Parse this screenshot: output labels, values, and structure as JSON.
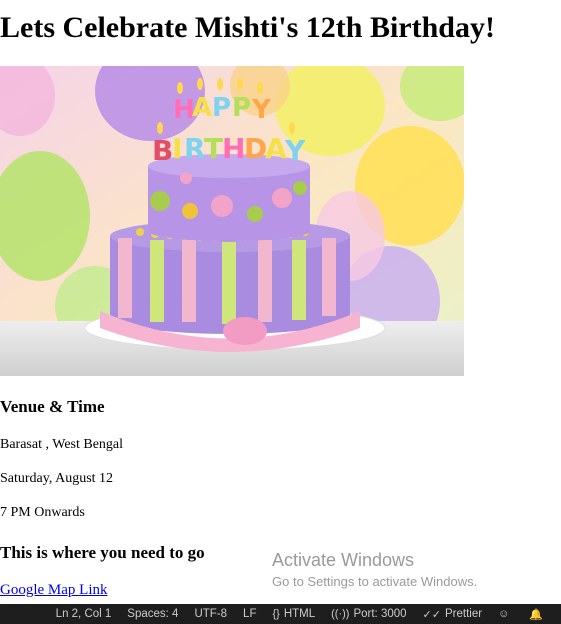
{
  "page": {
    "title": "Lets Celebrate Mishti's 12th Birthday!",
    "hero_topper_text": "HAPPY BIRTHDAY",
    "venue_heading": "Venue & Time",
    "location": "Barasat , West Bengal",
    "date": "Saturday, August 12",
    "time": "7 PM Onwards",
    "directions_heading": "This is where you need to go",
    "map_link": "Google Map Link"
  },
  "watermark": {
    "line1": "Activate Windows",
    "line2": "Go to Settings to activate Windows."
  },
  "statusbar": {
    "position": "Ln 2, Col 1",
    "spaces": "Spaces: 4",
    "encoding": "UTF-8",
    "eol": "LF",
    "language": "HTML",
    "port": "Port: 3000",
    "prettier": "Prettier",
    "icons": [
      "braces-icon",
      "broadcast-icon",
      "check-double-icon",
      "person-feedback-icon",
      "bell-icon"
    ]
  }
}
